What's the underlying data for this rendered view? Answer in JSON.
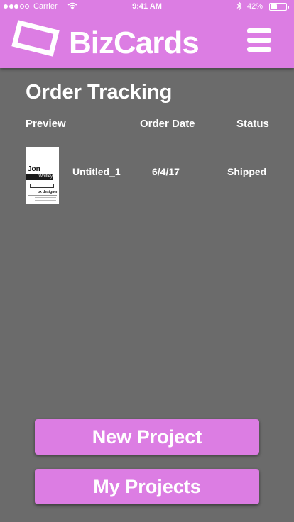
{
  "status_bar": {
    "carrier": "Carrier",
    "time": "9:41 AM",
    "battery": "42%",
    "battery_level": 0.42,
    "signal_bars_filled": 3,
    "signal_bars_total": 5,
    "icons": [
      "wifi-icon",
      "bluetooth-icon",
      "battery-icon"
    ]
  },
  "header": {
    "title": "BizCards",
    "logo_icon": "card-logo-icon",
    "menu_icon": "hamburger-menu-icon",
    "background_color": "#dc7de3"
  },
  "page": {
    "title": "Order Tracking"
  },
  "table": {
    "columns": [
      "Preview",
      "Order Date",
      "Status"
    ],
    "rows": [
      {
        "name": "Untitled_1",
        "order_date": "6/4/17",
        "status": "Shipped",
        "card_preview": {
          "first_name": "Jon",
          "last_name": "Whitley",
          "role": "ux designer"
        }
      }
    ]
  },
  "buttons": {
    "new_project": "New Project",
    "my_projects": "My Projects"
  },
  "colors": {
    "accent": "#dc7de3",
    "background": "#6b6b6b",
    "text": "#ffffff"
  }
}
